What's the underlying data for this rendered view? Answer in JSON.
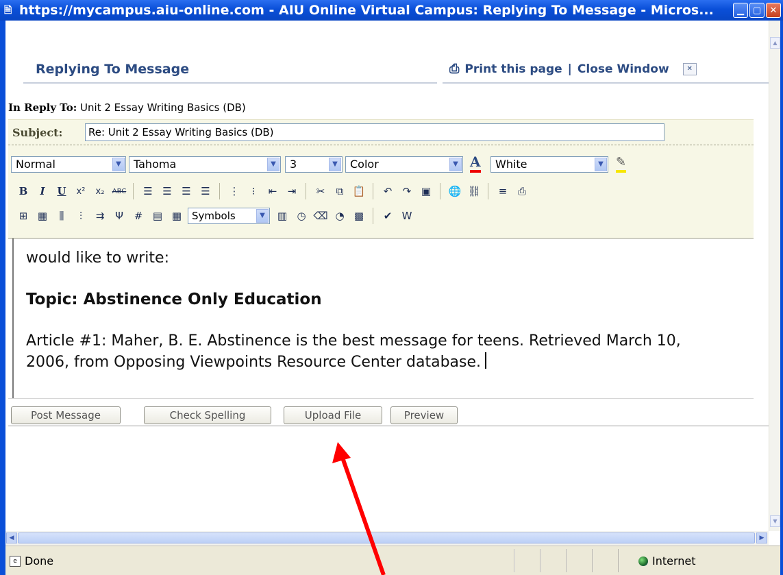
{
  "window": {
    "title": "https://mycampus.aiu-online.com - AIU Online Virtual Campus: Replying To Message - Micros..."
  },
  "header": {
    "page_title": "Replying To Message",
    "print_label": "Print this page",
    "separator": "|",
    "close_label": "Close Window"
  },
  "reply": {
    "label": "In Reply To:",
    "value": "Unit 2 Essay Writing Basics (DB)"
  },
  "subject": {
    "label": "Subject:",
    "value": "Re: Unit 2 Essay Writing Basics (DB)"
  },
  "toolbar": {
    "format_select": "Normal",
    "font_select": "Tahoma",
    "size_select": "3",
    "color_select": "Color",
    "bgcolor_select": "White",
    "symbols_select": "Symbols"
  },
  "editor": {
    "line1": "would like to write:",
    "topic": "Topic: Abstinence Only Education",
    "article_line1": "Article #1: Maher, B. E. Abstinence is the best message for teens. Retrieved March 10,",
    "article_line2": "2006, from Opposing Viewpoints Resource Center database."
  },
  "buttons": {
    "post": "Post Message",
    "spell": "Check Spelling",
    "upload": "Upload File",
    "preview": "Preview"
  },
  "statusbar": {
    "status": "Done",
    "zone": "Internet"
  },
  "colors": {
    "titlebar": "#0a4fd8",
    "link": "#2c4b82",
    "toolbar_bg": "#f7f7e6",
    "annotation_arrow": "#ff0000"
  }
}
